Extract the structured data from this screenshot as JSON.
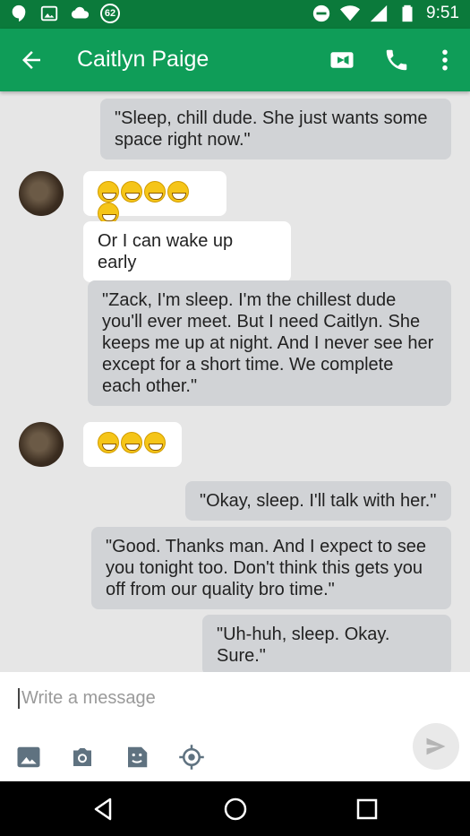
{
  "status_bar": {
    "notification_count": "62",
    "time": "9:51"
  },
  "header": {
    "contact_name": "Caitlyn Paige"
  },
  "messages": [
    {
      "direction": "out",
      "text": "\"Sleep, chill dude. She just wants some space right now.\""
    },
    {
      "direction": "in",
      "text": "emoji x5"
    },
    {
      "direction": "in",
      "text": "Or I can wake up early"
    },
    {
      "direction": "out",
      "text": "\"Zack, I'm sleep. I'm the chillest dude you'll ever meet. But I need Caitlyn. She keeps me up at night. And I never see her except for a short time. We complete each other.\""
    },
    {
      "direction": "in",
      "text": "emoji x3"
    },
    {
      "direction": "out",
      "text": "\"Okay, sleep. I'll talk with her.\""
    },
    {
      "direction": "out",
      "text": "\"Good. Thanks man. And I expect to see you tonight too. Don't think this gets you off from our quality bro time.\""
    },
    {
      "direction": "out",
      "text": "\"Uh-huh, sleep. Okay. Sure.\""
    }
  ],
  "composer": {
    "placeholder": "Write a message"
  },
  "colors": {
    "status_bar": "#0b7a3b",
    "app_bar": "#0f9d58",
    "bubble_out": "#d1d3d6",
    "bubble_in": "#ffffff"
  }
}
